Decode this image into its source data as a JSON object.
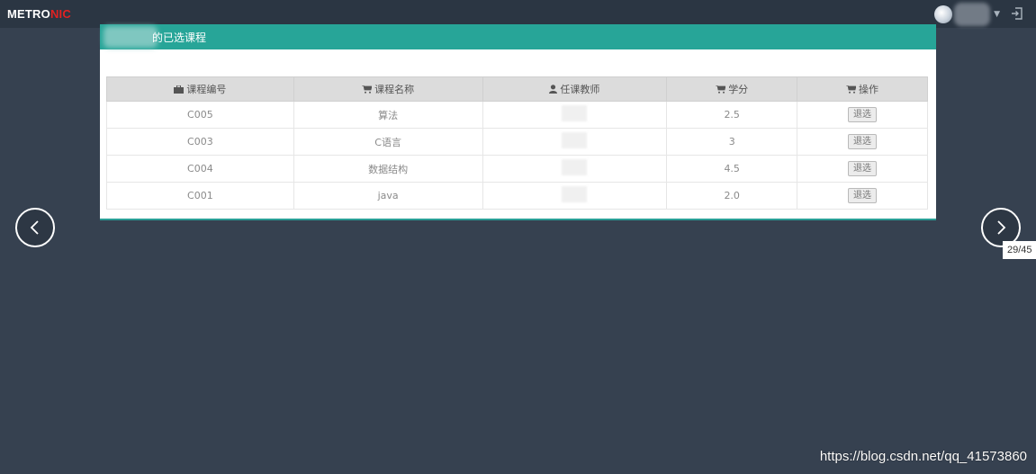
{
  "topbar": {
    "logo_main": "METRO",
    "logo_accent": "NIC"
  },
  "portlet": {
    "title": "的已选课程"
  },
  "table": {
    "headers": [
      {
        "icon": "briefcase-icon",
        "label": "课程编号"
      },
      {
        "icon": "cart-icon",
        "label": "课程名称"
      },
      {
        "icon": "user-icon",
        "label": "任课教师"
      },
      {
        "icon": "cart-icon",
        "label": "学分"
      },
      {
        "icon": "cart-icon",
        "label": "操作"
      }
    ],
    "rows": [
      {
        "code": "C005",
        "name": "算法",
        "teacher": "",
        "credit": "2.5",
        "action": "退选"
      },
      {
        "code": "C003",
        "name": "C语言",
        "teacher": "",
        "credit": "3",
        "action": "退选"
      },
      {
        "code": "C004",
        "name": "数据结构",
        "teacher": "",
        "credit": "4.5",
        "action": "退选"
      },
      {
        "code": "C001",
        "name": "java",
        "teacher": "",
        "credit": "2.0",
        "action": "退选"
      }
    ]
  },
  "gallery": {
    "counter": "29/45"
  },
  "watermark": "https://blog.csdn.net/qq_41573860",
  "colors": {
    "page_bg": "#364150",
    "topbar_bg": "#2b3643",
    "header_teal": "#27a598",
    "logo_accent": "#e02222"
  }
}
